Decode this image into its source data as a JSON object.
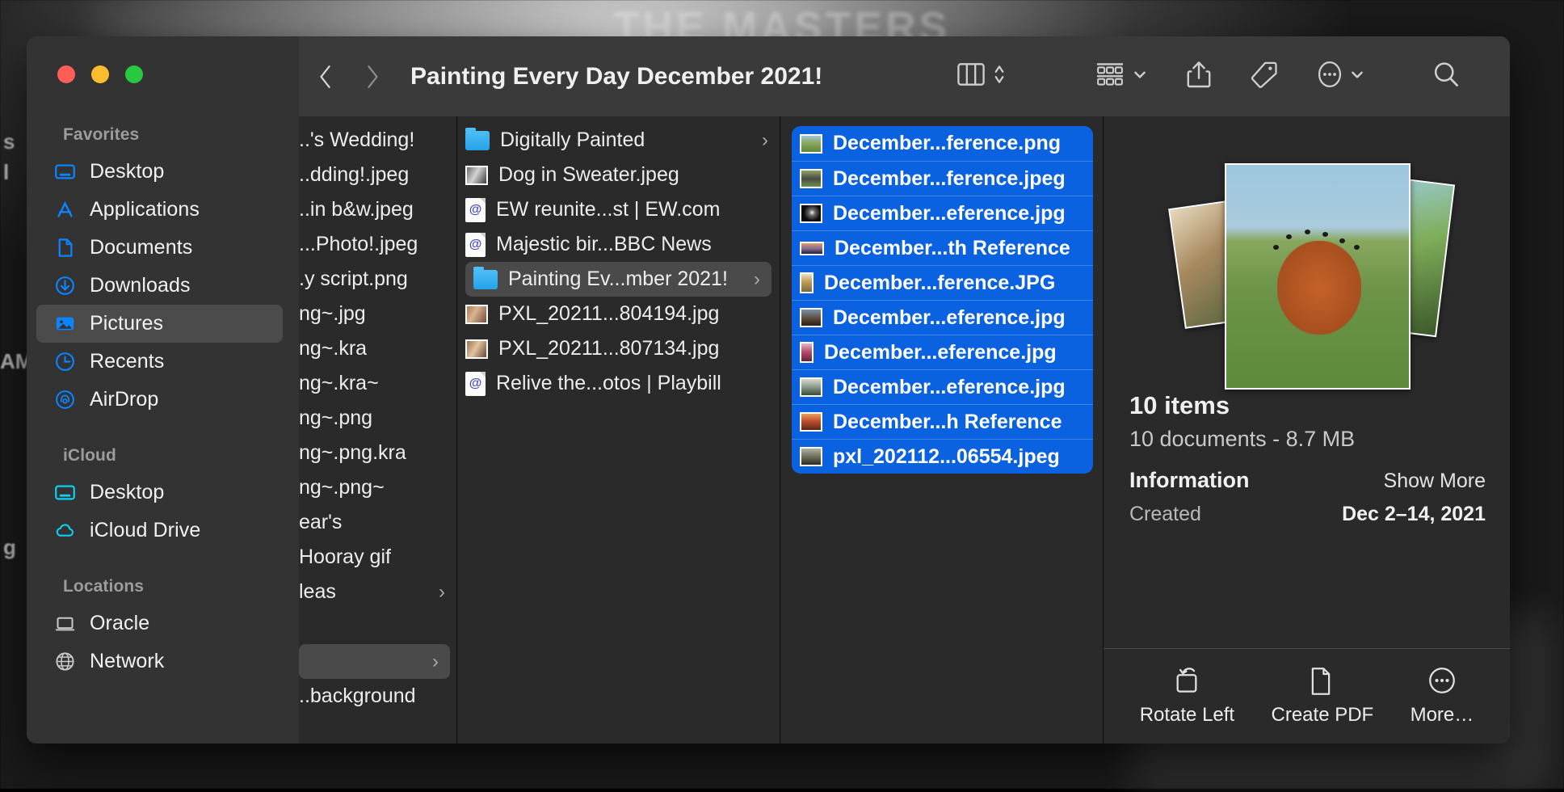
{
  "desktop": {
    "banner_text": "THE MASTERS",
    "left_labels": [
      "s",
      "l",
      "AM",
      "g"
    ]
  },
  "window": {
    "title": "Painting Every Day December 2021!",
    "traffic_lights": [
      {
        "name": "close-button",
        "color": "#ff5f57"
      },
      {
        "name": "minimize-button",
        "color": "#febc2e"
      },
      {
        "name": "maximize-button",
        "color": "#28c840"
      }
    ]
  },
  "toolbar": {
    "back_icon": "chevron-left-icon",
    "forward_icon": "chevron-right-icon",
    "view_icon": "column-view-icon",
    "view_sort_icon": "chevron-up-down-icon",
    "group_icon": "group-items-icon",
    "group_chevron": "chevron-down-icon",
    "share_icon": "share-icon",
    "tag_icon": "tag-icon",
    "more_icon": "more-ellipsis-icon",
    "more_chevron": "chevron-down-icon",
    "search_icon": "search-icon"
  },
  "sidebar": {
    "sections": [
      {
        "header": "Favorites",
        "items": [
          {
            "label": "Desktop",
            "icon": "desktop-icon",
            "selected": false
          },
          {
            "label": "Applications",
            "icon": "applications-icon",
            "selected": false
          },
          {
            "label": "Documents",
            "icon": "document-icon",
            "selected": false
          },
          {
            "label": "Downloads",
            "icon": "downloads-icon",
            "selected": false
          },
          {
            "label": "Pictures",
            "icon": "pictures-icon",
            "selected": true
          },
          {
            "label": "Recents",
            "icon": "clock-icon",
            "selected": false
          },
          {
            "label": "AirDrop",
            "icon": "airdrop-icon",
            "selected": false
          }
        ]
      },
      {
        "header": "iCloud",
        "items": [
          {
            "label": "Desktop",
            "icon": "desktop-icon",
            "selected": false
          },
          {
            "label": "iCloud Drive",
            "icon": "cloud-icon",
            "selected": false
          }
        ]
      },
      {
        "header": "Locations",
        "items": [
          {
            "label": "Oracle",
            "icon": "laptop-icon",
            "selected": false
          },
          {
            "label": "Network",
            "icon": "globe-icon",
            "selected": false
          }
        ]
      }
    ]
  },
  "columns": [
    {
      "name": "column-1",
      "rows": [
        {
          "label": "..'s Wedding!",
          "icon": "none",
          "selected": false,
          "disclosure": false
        },
        {
          "label": "..dding!.jpeg",
          "icon": "none",
          "selected": false,
          "disclosure": false
        },
        {
          "label": "..in b&w.jpeg",
          "icon": "none",
          "selected": false,
          "disclosure": false
        },
        {
          "label": "...Photo!.jpeg",
          "icon": "none",
          "selected": false,
          "disclosure": false
        },
        {
          "label": ".y script.png",
          "icon": "none",
          "selected": false,
          "disclosure": false
        },
        {
          "label": "ng~.jpg",
          "icon": "none",
          "selected": false,
          "disclosure": false
        },
        {
          "label": "ng~.kra",
          "icon": "none",
          "selected": false,
          "disclosure": false
        },
        {
          "label": "ng~.kra~",
          "icon": "none",
          "selected": false,
          "disclosure": false
        },
        {
          "label": "ng~.png",
          "icon": "none",
          "selected": false,
          "disclosure": false
        },
        {
          "label": "ng~.png.kra",
          "icon": "none",
          "selected": false,
          "disclosure": false
        },
        {
          "label": "ng~.png~",
          "icon": "none",
          "selected": false,
          "disclosure": false
        },
        {
          "label": "ear's",
          "icon": "none",
          "selected": false,
          "disclosure": false
        },
        {
          "label": "Hooray gif",
          "icon": "none",
          "selected": false,
          "disclosure": false
        },
        {
          "label": "leas",
          "icon": "none",
          "selected": false,
          "disclosure": true
        },
        {
          "label": "",
          "icon": "none",
          "selected": false,
          "disclosure": false
        },
        {
          "label": "",
          "icon": "none",
          "selected": true,
          "disclosure": true
        },
        {
          "label": "..background",
          "icon": "none",
          "selected": false,
          "disclosure": false
        }
      ]
    },
    {
      "name": "column-2",
      "rows": [
        {
          "label": "Digitally Painted",
          "icon": "folder-icon",
          "selected": false,
          "disclosure": true
        },
        {
          "label": "Dog in Sweater.jpeg",
          "icon": "photo-thumb-dog",
          "selected": false,
          "disclosure": false
        },
        {
          "label": "EW reunite...st | EW.com",
          "icon": "webloc-icon",
          "selected": false,
          "disclosure": false
        },
        {
          "label": "Majestic bir...BBC News",
          "icon": "webloc-icon",
          "selected": false,
          "disclosure": false
        },
        {
          "label": "Painting Ev...mber 2021!",
          "icon": "folder-icon",
          "selected": true,
          "disclosure": true
        },
        {
          "label": "PXL_20211...804194.jpg",
          "icon": "photo-thumb-room",
          "selected": false,
          "disclosure": false
        },
        {
          "label": "PXL_20211...807134.jpg",
          "icon": "photo-thumb-room2",
          "selected": false,
          "disclosure": false
        },
        {
          "label": "Relive the...otos | Playbill",
          "icon": "webloc-icon",
          "selected": false,
          "disclosure": false
        }
      ]
    },
    {
      "name": "column-3",
      "selection_count": 10,
      "rows": [
        {
          "label": "December...ference.png",
          "icon": "thumb-deer",
          "selected": true
        },
        {
          "label": "December...ference.jpeg",
          "icon": "thumb-rocks",
          "selected": true
        },
        {
          "label": "December...eference.jpg",
          "icon": "thumb-dark",
          "selected": true
        },
        {
          "label": "December...th Reference",
          "icon": "thumb-sunset",
          "selected": true
        },
        {
          "label": "December...ference.JPG",
          "icon": "thumb-figure",
          "selected": true
        },
        {
          "label": "December...eference.jpg",
          "icon": "thumb-landscape",
          "selected": true
        },
        {
          "label": "December...eference.jpg",
          "icon": "thumb-dancer",
          "selected": true
        },
        {
          "label": "December...eference.jpg",
          "icon": "thumb-bird",
          "selected": true
        },
        {
          "label": "December...h Reference",
          "icon": "thumb-warm",
          "selected": true
        },
        {
          "label": "pxl_202112...06554.jpeg",
          "icon": "thumb-photo",
          "selected": true
        }
      ]
    }
  ],
  "preview": {
    "item_count": "10 items",
    "item_summary": "10 documents - 8.7 MB",
    "information_title": "Information",
    "show_more": "Show More",
    "info_rows": [
      {
        "key": "Created",
        "value": "Dec 2–14, 2021"
      }
    ],
    "actions": [
      {
        "label": "Rotate Left",
        "icon": "rotate-left-icon"
      },
      {
        "label": "Create PDF",
        "icon": "document-icon"
      },
      {
        "label": "More…",
        "icon": "more-ellipsis-icon"
      }
    ]
  }
}
